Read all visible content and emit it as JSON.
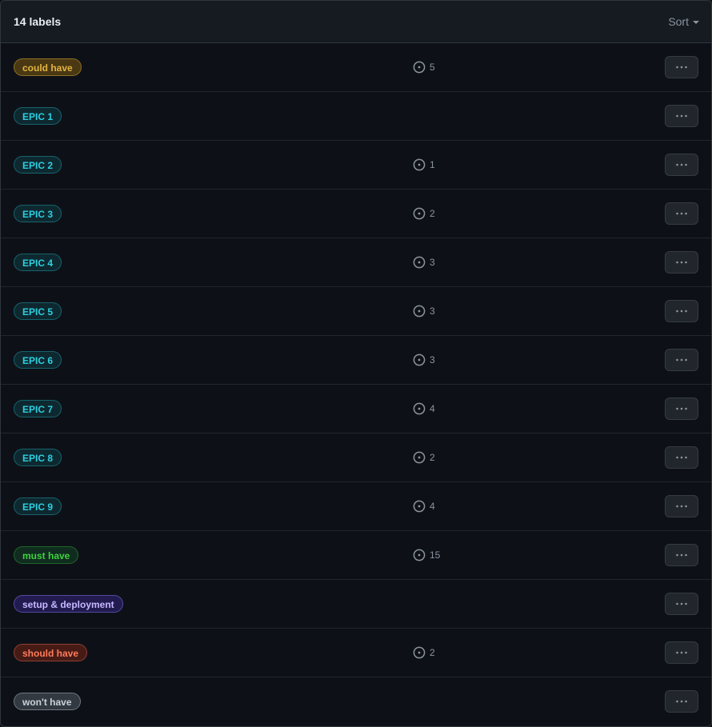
{
  "header": {
    "count_label": "14 labels",
    "sort_label": "Sort"
  },
  "icons": {
    "issue": "issue-opened-icon",
    "more": "kebab-horizontal-icon",
    "sort": "triangle-down-icon"
  },
  "labels": [
    {
      "name": "could have",
      "issues": "5",
      "fg": "#e3b341",
      "bg": "rgba(187,128,9,0.35)",
      "border": "rgba(227,179,65,0.45)"
    },
    {
      "name": "EPIC 1",
      "issues": "",
      "fg": "#2ccfe0",
      "bg": "rgba(23,148,165,0.18)",
      "border": "rgba(44,207,224,0.35)"
    },
    {
      "name": "EPIC 2",
      "issues": "1",
      "fg": "#2ccfe0",
      "bg": "rgba(23,148,165,0.18)",
      "border": "rgba(44,207,224,0.35)"
    },
    {
      "name": "EPIC 3",
      "issues": "2",
      "fg": "#2ccfe0",
      "bg": "rgba(23,148,165,0.18)",
      "border": "rgba(44,207,224,0.35)"
    },
    {
      "name": "EPIC 4",
      "issues": "3",
      "fg": "#2ccfe0",
      "bg": "rgba(23,148,165,0.18)",
      "border": "rgba(44,207,224,0.35)"
    },
    {
      "name": "EPIC 5",
      "issues": "3",
      "fg": "#2ccfe0",
      "bg": "rgba(23,148,165,0.18)",
      "border": "rgba(44,207,224,0.35)"
    },
    {
      "name": "EPIC 6",
      "issues": "3",
      "fg": "#2ccfe0",
      "bg": "rgba(23,148,165,0.18)",
      "border": "rgba(44,207,224,0.35)"
    },
    {
      "name": "EPIC 7",
      "issues": "4",
      "fg": "#2ccfe0",
      "bg": "rgba(23,148,165,0.18)",
      "border": "rgba(44,207,224,0.35)"
    },
    {
      "name": "EPIC 8",
      "issues": "2",
      "fg": "#2ccfe0",
      "bg": "rgba(23,148,165,0.18)",
      "border": "rgba(44,207,224,0.35)"
    },
    {
      "name": "EPIC 9",
      "issues": "4",
      "fg": "#2ccfe0",
      "bg": "rgba(23,148,165,0.18)",
      "border": "rgba(44,207,224,0.35)"
    },
    {
      "name": "must have",
      "issues": "15",
      "fg": "#3fd13f",
      "bg": "rgba(26,127,55,0.25)",
      "border": "rgba(63,209,63,0.35)"
    },
    {
      "name": "setup & deployment",
      "issues": "",
      "fg": "#c6b8ff",
      "bg": "rgba(60,40,150,0.45)",
      "border": "rgba(150,130,255,0.45)"
    },
    {
      "name": "should have",
      "issues": "2",
      "fg": "#ff7b5c",
      "bg": "rgba(140,40,20,0.45)",
      "border": "rgba(255,123,92,0.4)"
    },
    {
      "name": "won't have",
      "issues": "",
      "fg": "#c9d1d9",
      "bg": "rgba(110,118,129,0.4)",
      "border": "rgba(201,209,217,0.4)"
    }
  ]
}
